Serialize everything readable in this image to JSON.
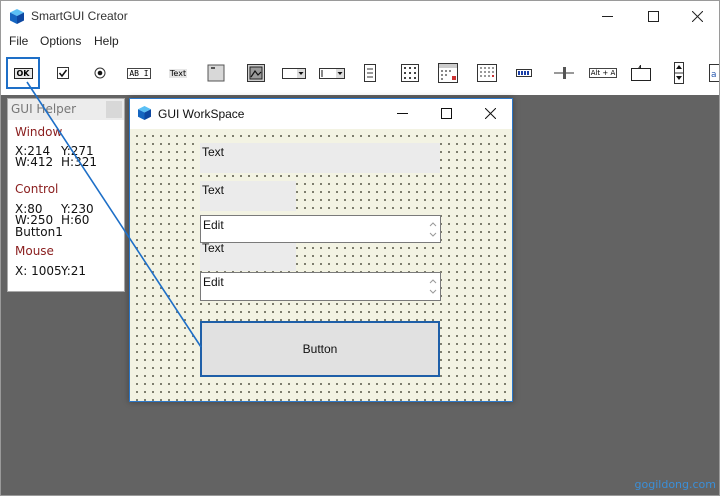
{
  "app": {
    "title": "SmartGUI Creator"
  },
  "menu": {
    "items": [
      "File",
      "Options",
      "Help"
    ]
  },
  "toolbar": {
    "tools": [
      {
        "name": "button-tool",
        "label": "OK"
      },
      {
        "name": "checkbox-tool",
        "label": ""
      },
      {
        "name": "radio-tool",
        "label": ""
      },
      {
        "name": "edit-tool",
        "label": "AB I"
      },
      {
        "name": "text-tool",
        "label": "Text"
      },
      {
        "name": "groupbox-tool",
        "label": ""
      },
      {
        "name": "picture-tool",
        "label": ""
      },
      {
        "name": "dropdown-tool",
        "label": ""
      },
      {
        "name": "combobox-tool",
        "label": ""
      },
      {
        "name": "listbox-tool",
        "label": ""
      },
      {
        "name": "listview-tool",
        "label": ""
      },
      {
        "name": "datetime-tool",
        "label": ""
      },
      {
        "name": "monthcal-tool",
        "label": ""
      },
      {
        "name": "progress-tool",
        "label": ""
      },
      {
        "name": "slider-tool",
        "label": ""
      },
      {
        "name": "hotkey-tool",
        "label": "Alt + A"
      },
      {
        "name": "tab-tool",
        "label": ""
      },
      {
        "name": "updown-tool",
        "label": ""
      }
    ]
  },
  "helper": {
    "title": "GUI Helper",
    "window": {
      "label": "Window",
      "x": "X:214",
      "y": "Y:271",
      "w": "W:412",
      "h": "H:321"
    },
    "control": {
      "label": "Control",
      "x": "X:80",
      "y": "Y:230",
      "w": "W:250",
      "h": "H:60",
      "name": "Button1"
    },
    "mouse": {
      "label": "Mouse",
      "x": "X: 1005",
      "y": "Y:21"
    }
  },
  "workspace": {
    "title": "GUI WorkSpace",
    "controls": {
      "text1": "Text",
      "text2": "Text",
      "edit1": "Edit",
      "text3": "Text",
      "edit2": "Edit",
      "button": "Button"
    }
  },
  "watermark": "gogildong.com",
  "colors": {
    "accent": "#1e6fc7",
    "helper_heading": "#8b2020",
    "canvas": "#636363",
    "grid_bg": "#f3f3e3"
  }
}
